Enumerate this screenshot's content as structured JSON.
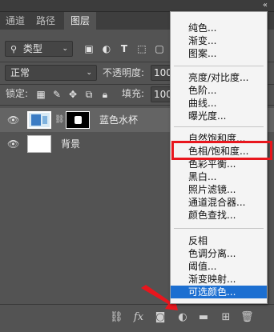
{
  "window": {
    "collapse_glyph": "«",
    "close_glyph": "✕"
  },
  "tabs": [
    {
      "label": "通道",
      "active": false
    },
    {
      "label": "路径",
      "active": false
    },
    {
      "label": "图层",
      "active": true
    }
  ],
  "filter": {
    "kind_label": "类型"
  },
  "blend": {
    "mode": "正常",
    "opacity_label": "不透明度:",
    "opacity_value": "100%"
  },
  "lock": {
    "label": "锁定:",
    "fill_label": "填充:",
    "fill_value": "100%"
  },
  "layers": [
    {
      "name": "蓝色水杯",
      "selected": true
    },
    {
      "name": "背景",
      "selected": false
    }
  ],
  "menu": {
    "groups": [
      [
        "纯色...",
        "渐变...",
        "图案..."
      ],
      [
        "亮度/对比度...",
        "色阶...",
        "曲线...",
        "曝光度..."
      ],
      [
        "自然饱和度...",
        "色相/饱和度...",
        "色彩平衡...",
        "黑白...",
        "照片滤镜...",
        "通道混合器...",
        "颜色查找..."
      ],
      [
        "反相",
        "色调分离...",
        "阈值...",
        "渐变映射...",
        "可选颜色..."
      ]
    ],
    "highlighted": "可选颜色...",
    "boxed": "色相/饱和度..."
  },
  "colors": {
    "accent": "#1c6fd1",
    "annotation": "#e8161d",
    "panel_bg": "#535353"
  }
}
